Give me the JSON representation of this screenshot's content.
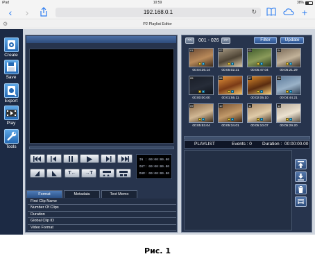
{
  "status_bar": {
    "device": "iPad",
    "time": "10:59",
    "battery": "38%"
  },
  "browser": {
    "url": "192.168.0.1",
    "icons": [
      "back-icon",
      "forward-icon",
      "share-icon",
      "reload-icon",
      "bookmarks-icon",
      "cloud-tabs-icon",
      "new-tab-icon"
    ]
  },
  "page": {
    "title": "P2 Playlist Editor"
  },
  "toolbar": {
    "items": [
      {
        "label": "Create",
        "icon": "create-icon"
      },
      {
        "label": "Save",
        "icon": "save-icon"
      },
      {
        "label": "Export",
        "icon": "export-icon"
      },
      {
        "label": "Play",
        "icon": "play-film-icon"
      },
      {
        "label": "Tools",
        "icon": "wrench-icon"
      }
    ]
  },
  "player": {
    "controls_row1": [
      "skip-to-start-icon",
      "step-back-icon",
      "pause-icon",
      "play-icon",
      "step-forward-icon",
      "skip-to-end-icon"
    ],
    "controls_row2": [
      {
        "label": "",
        "icon": "mark-in-icon"
      },
      {
        "label": "",
        "icon": "mark-out-icon"
      },
      {
        "label": "T←",
        "icon": "trim-in-icon"
      },
      {
        "label": "→T",
        "icon": "trim-out-icon"
      },
      {
        "label": "",
        "icon": "split-a-icon"
      },
      {
        "label": "",
        "icon": "split-b-icon"
      }
    ],
    "timecode": {
      "in_label": "IN :",
      "in_value": "00:00:00.00",
      "out_label": "OUT:",
      "out_value": "00:00:00.00",
      "dur_label": "DUR:",
      "dur_value": "00:00:00.00"
    }
  },
  "tabs": [
    {
      "label": "Format",
      "active": true
    },
    {
      "label": "Metadata",
      "active": false
    },
    {
      "label": "Text Memo",
      "active": false
    }
  ],
  "properties": [
    "First Clip Name",
    "Number Of Clips",
    "Duration",
    "Global Clip ID",
    "Video Format"
  ],
  "clip_browser": {
    "range": "001 - 026",
    "filter_label": "Filter",
    "update_label": "Update",
    "clips": [
      {
        "num": "01",
        "duration": "00:04:36.14",
        "colors": [
          "#6b4a34",
          "#b98a5a",
          "#3b2a1c"
        ]
      },
      {
        "num": "02",
        "duration": "00:05:02.21",
        "colors": [
          "#a89b84",
          "#4e4435",
          "#d8c9a8"
        ]
      },
      {
        "num": "03",
        "duration": "00:05:47.04",
        "colors": [
          "#3d5a2a",
          "#8a9a5a",
          "#2a3a1e"
        ]
      },
      {
        "num": "04",
        "duration": "00:05:21.29",
        "colors": [
          "#7a6a58",
          "#c2b299",
          "#3c332a"
        ]
      },
      {
        "num": "05",
        "duration": "00:00:00.00",
        "colors": [
          "#191e28",
          "#262c38",
          "#10141b"
        ]
      },
      {
        "num": "06",
        "duration": "00:01:55.11",
        "colors": [
          "#e2923a",
          "#7a3a16",
          "#f2c46a"
        ]
      },
      {
        "num": "07",
        "duration": "00:02:05.10",
        "colors": [
          "#d8892c",
          "#5a2c10",
          "#f6d07a"
        ]
      },
      {
        "num": "08",
        "duration": "00:04:44.21",
        "colors": [
          "#5c7a9a",
          "#9ab2c8",
          "#2c3c50"
        ]
      },
      {
        "num": "09",
        "duration": "00:05:53.04",
        "colors": [
          "#8a6a4a",
          "#d2b894",
          "#3a2a1a"
        ]
      },
      {
        "num": "10",
        "duration": "00:05:34.01",
        "colors": [
          "#7a5434",
          "#c29a6a",
          "#3a2414"
        ]
      },
      {
        "num": "11",
        "duration": "00:05:10.07",
        "colors": [
          "#a88a6a",
          "#e0cba8",
          "#4a3a2a"
        ]
      },
      {
        "num": "12",
        "duration": "00:05:29.20",
        "colors": [
          "#b8aa98",
          "#ece2d0",
          "#5a5044"
        ]
      }
    ]
  },
  "playlist": {
    "label": "PLAYLIST",
    "events_label": "Events : 0",
    "duration_label": "Duration :",
    "duration_value": "00:00:00.00",
    "buttons": [
      "move-up-icon",
      "move-down-icon",
      "trash-icon",
      "adjust-icon"
    ]
  },
  "caption": "Рис. 1"
}
